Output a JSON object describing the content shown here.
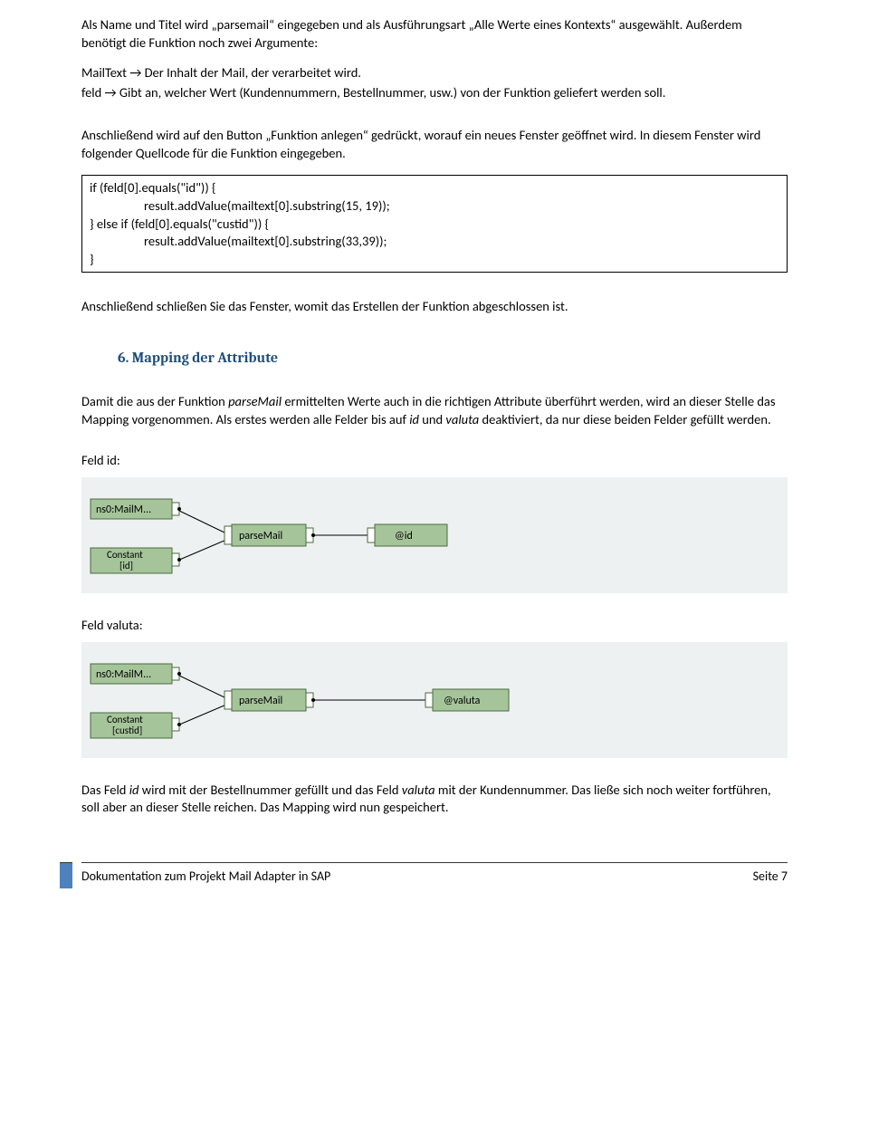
{
  "para1": "Als Name und Titel wird „parsemail“ eingegeben und als Ausführungsart „Alle Werte eines Kontexts“ ausgewählt. Außerdem benötigt die Funktion noch zwei Argumente:",
  "arg1": "MailText → Der Inhalt der Mail, der verarbeitet wird.",
  "arg2": "feld → Gibt an, welcher Wert (Kundennummern, Bestellnummer, usw.) von der Funktion geliefert werden soll.",
  "para2": "Anschließend wird auf den Button „Funktion anlegen“ gedrückt, worauf  ein neues Fenster geöffnet wird. In diesem Fenster wird folgender Quellcode für die Funktion eingegeben.",
  "code": {
    "l1": "if (feld[0].equals(\"id\")) {",
    "l2": "result.addValue(mailtext[0].substring(15, 19));",
    "l3": "} else if (feld[0].equals(\"custid\")) {",
    "l4": "result.addValue(mailtext[0].substring(33,39));",
    "l5": "}"
  },
  "para3": "Anschließend schließen Sie das Fenster, womit das Erstellen der Funktion abgeschlossen ist.",
  "heading": "6.   Mapping der Attribute",
  "para4_a": "Damit die aus der Funktion ",
  "para4_i1": "parseMail",
  "para4_b": " ermittelten Werte auch in die richtigen Attribute überführt werden, wird an dieser Stelle das Mapping vorgenommen. Als erstes werden alle Felder bis auf ",
  "para4_i2": "id",
  "para4_c": " und ",
  "para4_i3": "valuta",
  "para4_d": " deaktiviert, da nur diese beiden Felder gefüllt werden.",
  "label_id": "Feld id:",
  "label_valuta": "Feld valuta:",
  "diagram1": {
    "n1": "ns0:MailM...",
    "n2": "Constant\n[id]",
    "n3": "parseMail",
    "n4": "@id"
  },
  "diagram2": {
    "n1": "ns0:MailM...",
    "n2": "Constant\n[custid]",
    "n3": "parseMail",
    "n4": "@valuta"
  },
  "para5_a": "Das Feld ",
  "para5_i1": "id",
  "para5_b": " wird mit der Bestellnummer gefüllt und das Feld ",
  "para5_i2": "valuta",
  "para5_c": " mit der Kundennummer. Das ließe sich noch weiter fortführen, soll aber an dieser Stelle reichen.  Das Mapping wird nun gespeichert.",
  "footer_left": "Dokumentation zum Projekt Mail Adapter in SAP",
  "footer_right": "Seite 7"
}
